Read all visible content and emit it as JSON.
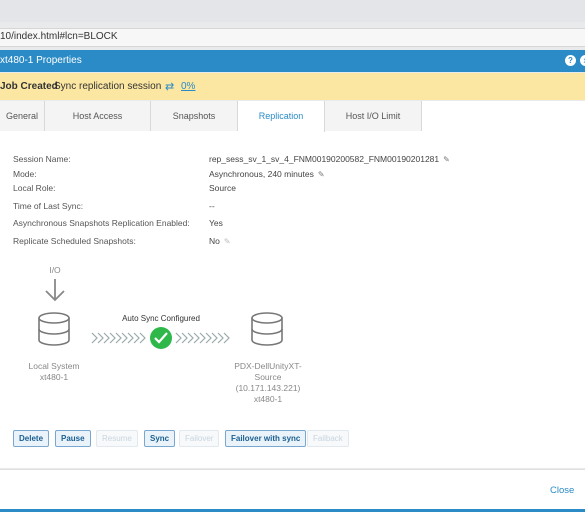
{
  "browser": {
    "url": "10/index.html#lcn=BLOCK"
  },
  "dialog": {
    "title": "xt480-1 Properties",
    "help_icon": "?",
    "close_icon": "x"
  },
  "job": {
    "title": "Job Created",
    "message": "Sync replication session",
    "progress": "0%"
  },
  "tabs": [
    {
      "label": "General"
    },
    {
      "label": "Host Access"
    },
    {
      "label": "Snapshots"
    },
    {
      "label": "Replication"
    },
    {
      "label": "Host I/O Limit"
    }
  ],
  "details": [
    {
      "label": "Session Name:",
      "value": "rep_sess_sv_1_sv_4_FNM00190200582_FNM00190201281"
    },
    {
      "label": "Mode:",
      "value": "Asynchronous, 240 minutes"
    },
    {
      "label": "Local Role:",
      "value": "Source"
    },
    {
      "label": "Time of Last Sync:",
      "value": "--"
    },
    {
      "label": "Asynchronous Snapshots Replication Enabled:",
      "value": "Yes"
    },
    {
      "label": "Replicate Scheduled Snapshots:",
      "value": "No"
    }
  ],
  "diagram": {
    "io_label": "I/O",
    "status_label": "Auto Sync Configured",
    "local_name": "Local System",
    "local_sub": "xt480-1",
    "remote_line1": "PDX-DellUnityXT-",
    "remote_line2": "Source",
    "remote_line3": "(10.171.143.221)",
    "remote_line4": "xt480-1"
  },
  "actions": [
    {
      "label": "Delete",
      "enabled": true
    },
    {
      "label": "Pause",
      "enabled": true
    },
    {
      "label": "Resume",
      "enabled": false
    },
    {
      "label": "Sync",
      "enabled": true
    },
    {
      "label": "Failover",
      "enabled": false
    },
    {
      "label": "Failover with sync",
      "enabled": true
    },
    {
      "label": "Failback",
      "enabled": false
    }
  ],
  "footer": {
    "close_label": "Close"
  },
  "colors": {
    "accent": "#2b8bc6",
    "banner": "#fbe6a2",
    "success": "#2eb84a"
  }
}
